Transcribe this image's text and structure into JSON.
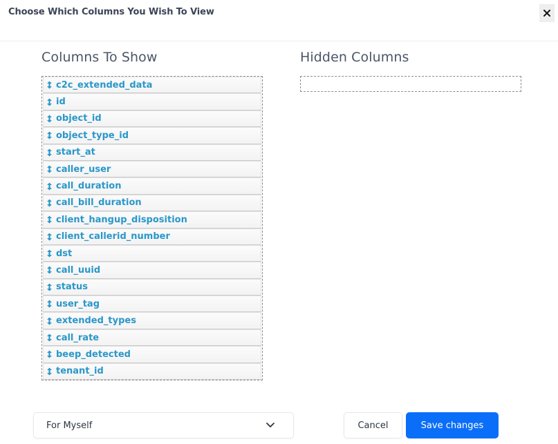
{
  "modal": {
    "title": "Choose Which Columns You Wish To View",
    "close_icon": "close-icon"
  },
  "columns_to_show": {
    "title": "Columns To Show",
    "item_icon": "sort-vertical-icon",
    "items": [
      {
        "label": "c2c_extended_data"
      },
      {
        "label": "id"
      },
      {
        "label": "object_id"
      },
      {
        "label": "object_type_id"
      },
      {
        "label": "start_at"
      },
      {
        "label": "caller_user"
      },
      {
        "label": "call_duration"
      },
      {
        "label": "call_bill_duration"
      },
      {
        "label": "client_hangup_disposition"
      },
      {
        "label": "client_callerid_number"
      },
      {
        "label": "dst"
      },
      {
        "label": "call_uuid"
      },
      {
        "label": "status"
      },
      {
        "label": "user_tag"
      },
      {
        "label": "extended_types"
      },
      {
        "label": "call_rate"
      },
      {
        "label": "beep_detected"
      },
      {
        "label": "tenant_id"
      }
    ]
  },
  "hidden_columns": {
    "title": "Hidden Columns",
    "items": []
  },
  "footer": {
    "scope_select": {
      "selected": "For Myself",
      "icon": "chevron-down-icon"
    },
    "cancel_label": "Cancel",
    "save_label": "Save changes"
  },
  "colors": {
    "accent": "#0b6ef9",
    "column_label": "#2a97c9",
    "heading": "#4b5567"
  }
}
